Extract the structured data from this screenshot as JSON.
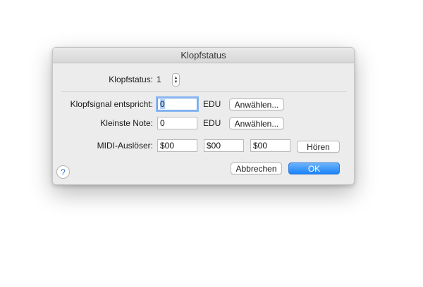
{
  "dialog": {
    "title": "Klopfstatus",
    "status_label": "Klopfstatus:",
    "status_value": "1",
    "signal_label": "Klopfsignal entspricht:",
    "signal_value": "0",
    "signal_unit": "EDU",
    "signal_choose": "Anwählen...",
    "smallest_label": "Kleinste Note:",
    "smallest_value": "0",
    "smallest_unit": "EDU",
    "smallest_choose": "Anwählen...",
    "midi_label": "MIDI-Auslöser:",
    "midi_values": [
      "$00",
      "$00",
      "$00"
    ],
    "listen_button": "Hören",
    "help": "?",
    "cancel_button": "Abbrechen",
    "ok_button": "OK"
  },
  "colors": {
    "accent": "#1a82fb",
    "focus": "#8cb7f3"
  }
}
